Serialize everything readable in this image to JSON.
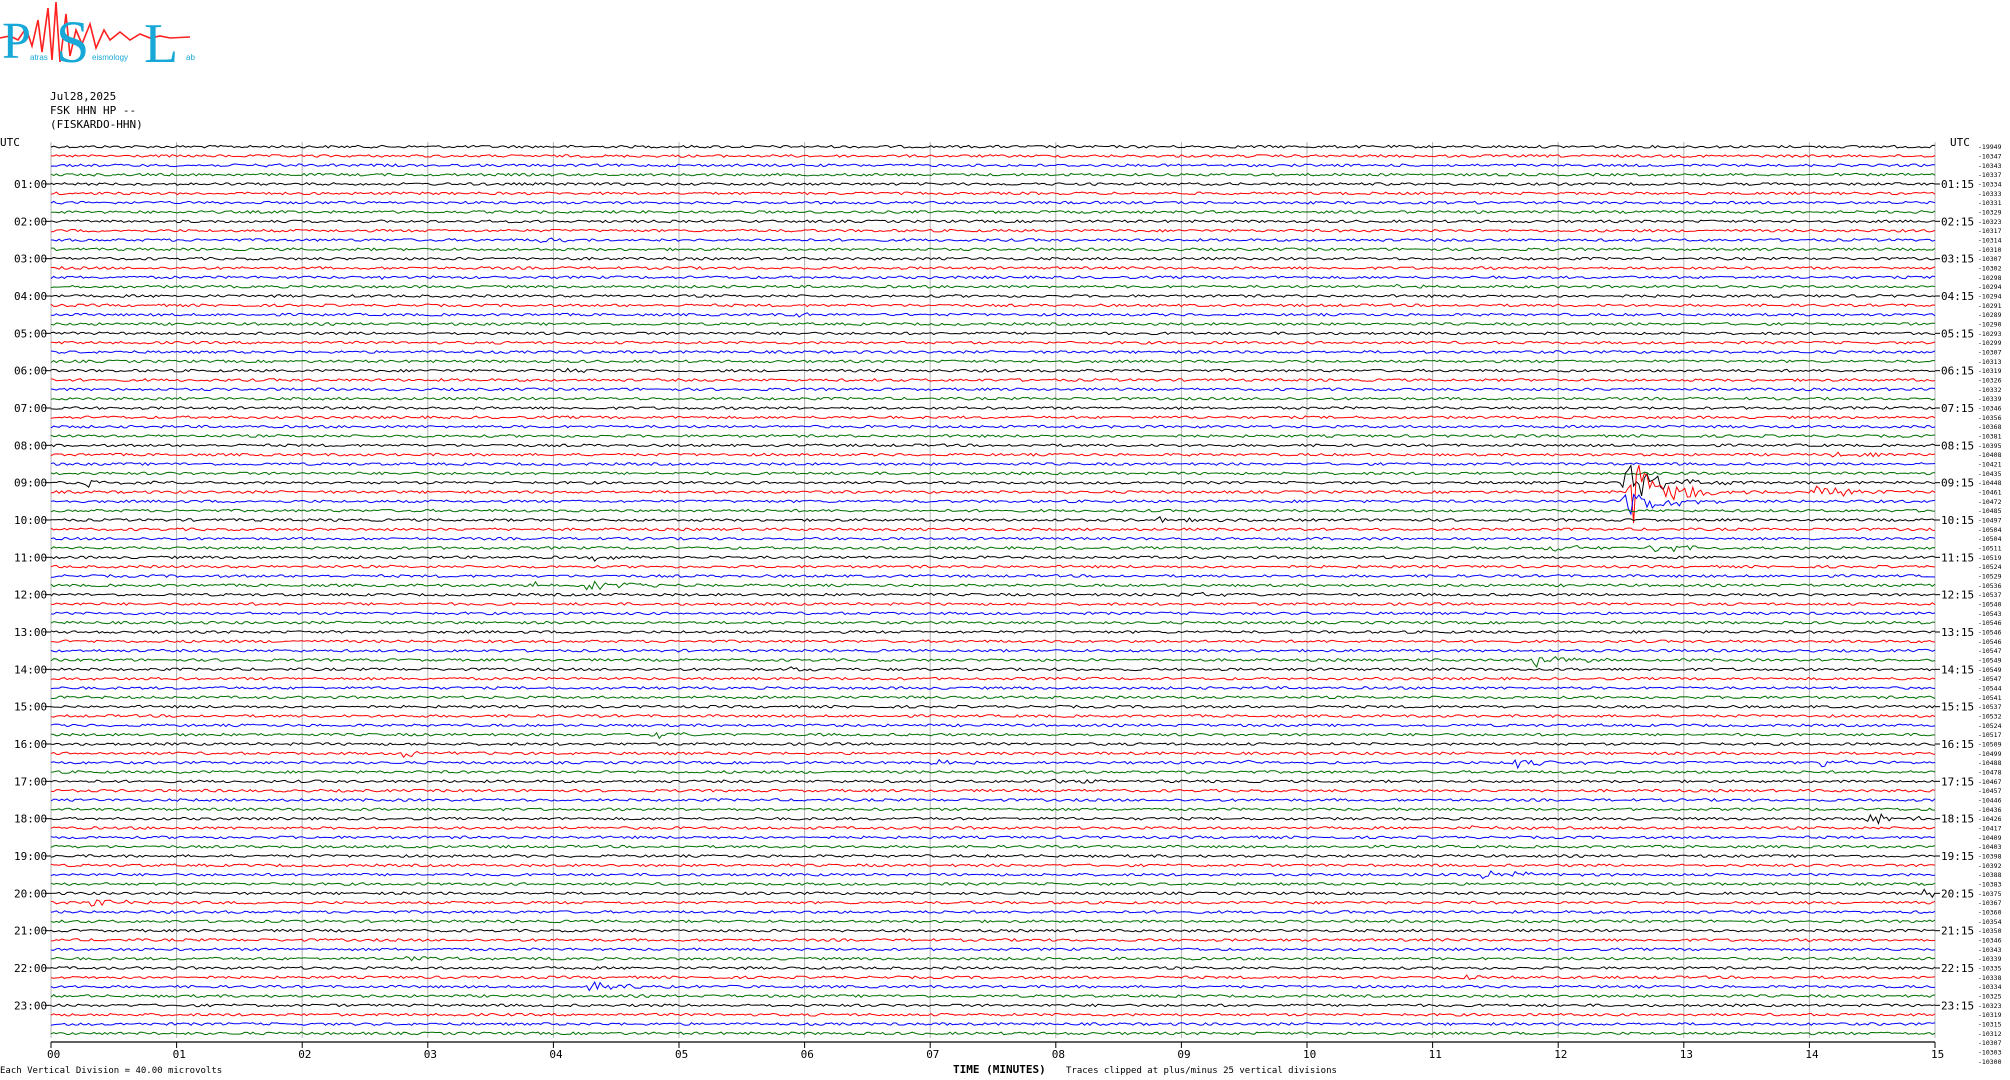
{
  "header": {
    "date": "Jul28,2025",
    "station": "FSK HHN HP --",
    "station_name": "(FISKARDO-HHN)"
  },
  "logo": {
    "letters": [
      "P",
      "S",
      "L"
    ],
    "subtext": [
      "atras",
      "eismology",
      "ab"
    ]
  },
  "footer": {
    "vertical_division": "Each Vertical Division =   40.00 microvolts",
    "clipping": "Traces clipped at plus/minus 25 vertical divisions"
  },
  "chart_data": {
    "type": "line",
    "x_title": "TIME (MINUTES)",
    "xlim": [
      0,
      15
    ],
    "x_ticks": [
      "00",
      "01",
      "02",
      "03",
      "04",
      "05",
      "06",
      "07",
      "08",
      "09",
      "10",
      "11",
      "12",
      "13",
      "14",
      "15"
    ],
    "left_axis_title": "UTC",
    "right_axis_title": "UTC",
    "left_hour_labels": [
      "01:00",
      "02:00",
      "03:00",
      "04:00",
      "05:00",
      "06:00",
      "07:00",
      "08:00",
      "09:00",
      "10:00",
      "11:00",
      "12:00",
      "13:00",
      "14:00",
      "15:00",
      "16:00",
      "17:00",
      "18:00",
      "19:00",
      "20:00",
      "21:00",
      "22:00",
      "23:00"
    ],
    "right_hour_labels": [
      "01:15",
      "02:15",
      "03:15",
      "04:15",
      "05:15",
      "06:15",
      "07:15",
      "08:15",
      "09:15",
      "10:15",
      "11:15",
      "12:15",
      "13:15",
      "14:15",
      "15:15",
      "16:15",
      "17:15",
      "18:15",
      "19:15",
      "20:15",
      "21:15",
      "22:15",
      "23:15"
    ],
    "trace_count": 96,
    "traces_per_hour": 4,
    "minutes_per_trace": 15,
    "trace_colors": [
      "#000000",
      "#ff0000",
      "#0000ff",
      "#007000"
    ],
    "grid": true,
    "offsets": [
      -19949,
      -10347,
      -10343,
      -10337,
      -10334,
      -10333,
      -10331,
      -10329,
      -10323,
      -10317,
      -10314,
      -10310,
      -10307,
      -10302,
      -10298,
      -10294,
      -10294,
      -10291,
      -10289,
      -10290,
      -10293,
      -10299,
      -10307,
      -10313,
      -10319,
      -10326,
      -10332,
      -10339,
      -10346,
      -10356,
      -10368,
      -10381,
      -10395,
      -10408,
      -10421,
      -10435,
      -10448,
      -10461,
      -10472,
      -10485,
      -10497,
      -10504,
      -10504,
      -10511,
      -10519,
      -10524,
      -10529,
      -10536,
      -10537,
      -10540,
      -10543,
      -10546,
      -10546,
      -10546,
      -10547,
      -10549,
      -10549,
      -10547,
      -10544,
      -10541,
      -10537,
      -10532,
      -10524,
      -10517,
      -10509,
      -10499,
      -10488,
      -10478,
      -10467,
      -10457,
      -10446,
      -10436,
      -10426,
      -10417,
      -10409,
      -10403,
      -10398,
      -10392,
      -10388,
      -10383,
      -10375,
      -10367,
      -10360,
      -10354,
      -10350,
      -10346,
      -10343,
      -10339,
      -10335,
      -10338,
      -10334,
      -10325,
      -10323,
      -10319,
      -10315,
      -10312,
      -10307,
      -10303,
      -10300
    ],
    "events": [
      {
        "trace": 2,
        "minute": 1.6,
        "amp": 3
      },
      {
        "trace": 10,
        "minute": 3.9,
        "amp": 3
      },
      {
        "trace": 14,
        "minute": 2.6,
        "amp": 2
      },
      {
        "trace": 15,
        "minute": 10.6,
        "amp": 2
      },
      {
        "trace": 18,
        "minute": 5.9,
        "amp": 2
      },
      {
        "trace": 24,
        "minute": 4.1,
        "amp": 2
      },
      {
        "trace": 33,
        "minute": 14.2,
        "amp": 3
      },
      {
        "trace": 36,
        "minute": 0.25,
        "amp": 4
      },
      {
        "trace": 36,
        "minute": 12.55,
        "amp": 22
      },
      {
        "trace": 37,
        "minute": 12.6,
        "amp": 34
      },
      {
        "trace": 37,
        "minute": 14.05,
        "amp": 7
      },
      {
        "trace": 38,
        "minute": 12.55,
        "amp": 18
      },
      {
        "trace": 40,
        "minute": 8.8,
        "amp": 3
      },
      {
        "trace": 42,
        "minute": 9.7,
        "amp": 3
      },
      {
        "trace": 43,
        "minute": 11.9,
        "amp": 4
      },
      {
        "trace": 43,
        "minute": 12.75,
        "amp": 5
      },
      {
        "trace": 44,
        "minute": 4.3,
        "amp": 4
      },
      {
        "trace": 47,
        "minute": 4.25,
        "amp": 7
      },
      {
        "trace": 47,
        "minute": 3.8,
        "amp": 3
      },
      {
        "trace": 48,
        "minute": 9.0,
        "amp": 2
      },
      {
        "trace": 55,
        "minute": 11.8,
        "amp": 7
      },
      {
        "trace": 56,
        "minute": 5.9,
        "amp": 2
      },
      {
        "trace": 63,
        "minute": 4.8,
        "amp": 3
      },
      {
        "trace": 65,
        "minute": 2.8,
        "amp": 4
      },
      {
        "trace": 66,
        "minute": 7.0,
        "amp": 3
      },
      {
        "trace": 66,
        "minute": 9.4,
        "amp": 3
      },
      {
        "trace": 66,
        "minute": 11.65,
        "amp": 5
      },
      {
        "trace": 66,
        "minute": 14.1,
        "amp": 4
      },
      {
        "trace": 68,
        "minute": 8.0,
        "amp": 2
      },
      {
        "trace": 72,
        "minute": 14.45,
        "amp": 6
      },
      {
        "trace": 73,
        "minute": 11.3,
        "amp": 2
      },
      {
        "trace": 78,
        "minute": 11.4,
        "amp": 8
      },
      {
        "trace": 81,
        "minute": 0.3,
        "amp": 4
      },
      {
        "trace": 80,
        "minute": 14.9,
        "amp": 4
      },
      {
        "trace": 87,
        "minute": 2.8,
        "amp": 3
      },
      {
        "trace": 89,
        "minute": 11.2,
        "amp": 2
      },
      {
        "trace": 90,
        "minute": 4.3,
        "amp": 4
      }
    ]
  }
}
